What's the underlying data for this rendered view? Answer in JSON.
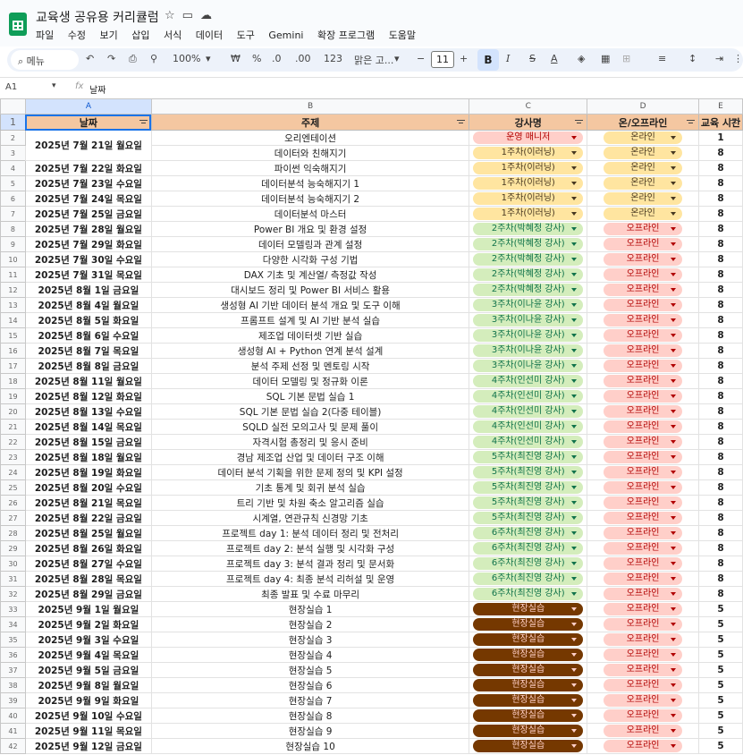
{
  "app": {
    "title": "교육생 공유용 커리큘럼",
    "menu": [
      "파일",
      "수정",
      "보기",
      "삽입",
      "서식",
      "데이터",
      "도구",
      "Gemini",
      "확장 프로그램",
      "도움말"
    ]
  },
  "toolbar": {
    "search_label": "메뉴",
    "zoom": "100%",
    "currency": "₩",
    "percent": "%",
    "dec_less": ".0",
    "dec_more": ".00",
    "number_format": "123",
    "font": "맑은 고...",
    "font_size": "11",
    "minus": "−",
    "plus": "+",
    "bold": "B",
    "italic": "I",
    "strike": "S",
    "textcolor": "A"
  },
  "formula_bar": {
    "cell_ref": "A1",
    "fx": "fx",
    "value": "날짜"
  },
  "columns": [
    "A",
    "B",
    "C",
    "D",
    "E"
  ],
  "headers": [
    "날짜",
    "주제",
    "강사명",
    "온/오프라인",
    "교육 시간"
  ],
  "colors": {
    "header_fill": "#f4c7a1",
    "selection": "#d3e3fd",
    "green_chip": "#d4edbc",
    "brown_chip": "#753800"
  },
  "rows": [
    {
      "n": "2",
      "date": "2025년 7월 21일 월요일",
      "topic": "오리엔테이션",
      "instructor": "운영 매니저",
      "chip": "mgr",
      "mode": "온라인",
      "hours": "1"
    },
    {
      "n": "3",
      "date": "",
      "topic": "데이터와 친해지기",
      "instructor": "1주차(이러닝)",
      "chip": "w1",
      "mode": "온라인",
      "hours": "8"
    },
    {
      "n": "4",
      "date": "2025년 7월 22일 화요일",
      "topic": "파이썬 익숙해지기",
      "instructor": "1주차(이러닝)",
      "chip": "w1",
      "mode": "온라인",
      "hours": "8"
    },
    {
      "n": "5",
      "date": "2025년 7월 23일 수요일",
      "topic": "데이터분석 능숙해지기 1",
      "instructor": "1주차(이러닝)",
      "chip": "w1",
      "mode": "온라인",
      "hours": "8"
    },
    {
      "n": "6",
      "date": "2025년 7월 24일 목요일",
      "topic": "데이터분석 능숙해지기 2",
      "instructor": "1주차(이러닝)",
      "chip": "w1",
      "mode": "온라인",
      "hours": "8"
    },
    {
      "n": "7",
      "date": "2025년 7월 25일 금요일",
      "topic": "데이터분석 마스터",
      "instructor": "1주차(이러닝)",
      "chip": "w1",
      "mode": "온라인",
      "hours": "8"
    },
    {
      "n": "8",
      "date": "2025년 7월 28일 월요일",
      "topic": "Power BI 개요 및 환경 설정",
      "instructor": "2주차(박혜정 강사)",
      "chip": "w2",
      "mode": "오프라인",
      "hours": "8"
    },
    {
      "n": "9",
      "date": "2025년 7월 29일 화요일",
      "topic": "데이터 모델링과 관계 설정",
      "instructor": "2주차(박혜정 강사)",
      "chip": "w2",
      "mode": "오프라인",
      "hours": "8"
    },
    {
      "n": "10",
      "date": "2025년 7월 30일 수요일",
      "topic": "다양한 시각화 구성 기법",
      "instructor": "2주차(박혜정 강사)",
      "chip": "w2",
      "mode": "오프라인",
      "hours": "8"
    },
    {
      "n": "11",
      "date": "2025년 7월 31일 목요일",
      "topic": "DAX 기초 및 계산열/ 측정값 작성",
      "instructor": "2주차(박혜정 강사)",
      "chip": "w2",
      "mode": "오프라인",
      "hours": "8"
    },
    {
      "n": "12",
      "date": "2025년 8월 1일 금요일",
      "topic": "대시보드 정리 및 Power BI 서비스 활용",
      "instructor": "2주차(박혜정 강사)",
      "chip": "w2",
      "mode": "오프라인",
      "hours": "8"
    },
    {
      "n": "13",
      "date": "2025년 8월 4일 월요일",
      "topic": "생성형 AI 기반 데이터 분석 개요 및 도구 이해",
      "instructor": "3주차(이나윤 강사)",
      "chip": "w3",
      "mode": "오프라인",
      "hours": "8"
    },
    {
      "n": "14",
      "date": "2025년 8월 5일 화요일",
      "topic": "프롬프트 설계 및 AI 기반 분석 실습",
      "instructor": "3주차(이나윤 강사)",
      "chip": "w3",
      "mode": "오프라인",
      "hours": "8"
    },
    {
      "n": "15",
      "date": "2025년 8월 6일 수요일",
      "topic": "제조업 데이터셋 기반 실습",
      "instructor": "3주차(이나윤 강사)",
      "chip": "w3",
      "mode": "오프라인",
      "hours": "8"
    },
    {
      "n": "16",
      "date": "2025년 8월 7일 목요일",
      "topic": "생성형 AI + Python 연계 분석 설계",
      "instructor": "3주차(이나윤 강사)",
      "chip": "w3",
      "mode": "오프라인",
      "hours": "8"
    },
    {
      "n": "17",
      "date": "2025년 8월 8일 금요일",
      "topic": "분석 주제 선정 및 멘토링 시작",
      "instructor": "3주차(이나윤 강사)",
      "chip": "w3",
      "mode": "오프라인",
      "hours": "8"
    },
    {
      "n": "18",
      "date": "2025년 8월 11일 월요일",
      "topic": "데이터 모델링 및 정규화 이론",
      "instructor": "4주차(인선미 강사)",
      "chip": "w4",
      "mode": "오프라인",
      "hours": "8"
    },
    {
      "n": "19",
      "date": "2025년 8월 12일 화요일",
      "topic": "SQL 기본 문법 실습 1",
      "instructor": "4주차(인선미 강사)",
      "chip": "w4",
      "mode": "오프라인",
      "hours": "8"
    },
    {
      "n": "20",
      "date": "2025년 8월 13일 수요일",
      "topic": "SQL 기본 문법 실습 2(다중 테이블)",
      "instructor": "4주차(인선미 강사)",
      "chip": "w4",
      "mode": "오프라인",
      "hours": "8"
    },
    {
      "n": "21",
      "date": "2025년 8월 14일 목요일",
      "topic": "SQLD 실전 모의고사 및 문제 풀이",
      "instructor": "4주차(인선미 강사)",
      "chip": "w4",
      "mode": "오프라인",
      "hours": "8"
    },
    {
      "n": "22",
      "date": "2025년 8월 15일 금요일",
      "topic": "자격시험 총정리 및 응시 준비",
      "instructor": "4주차(인선미 강사)",
      "chip": "w4",
      "mode": "오프라인",
      "hours": "8"
    },
    {
      "n": "23",
      "date": "2025년 8월 18일 월요일",
      "topic": "경남 제조업 산업 및 데이터 구조 이해",
      "instructor": "5주차(최진영 강사)",
      "chip": "w5",
      "mode": "오프라인",
      "hours": "8"
    },
    {
      "n": "24",
      "date": "2025년 8월 19일 화요일",
      "topic": "데이터 분석 기획을 위한 문제 정의 및 KPI 설정",
      "instructor": "5주차(최진영 강사)",
      "chip": "w5",
      "mode": "오프라인",
      "hours": "8"
    },
    {
      "n": "25",
      "date": "2025년 8월 20일 수요일",
      "topic": "기초 통계 및 회귀 분석 실습",
      "instructor": "5주차(최진영 강사)",
      "chip": "w5",
      "mode": "오프라인",
      "hours": "8"
    },
    {
      "n": "26",
      "date": "2025년 8월 21일 목요일",
      "topic": "트리 기반 및 차원 축소 알고리즘 실습",
      "instructor": "5주차(최진영 강사)",
      "chip": "w5",
      "mode": "오프라인",
      "hours": "8"
    },
    {
      "n": "27",
      "date": "2025년 8월 22일 금요일",
      "topic": "시계열, 연관규칙 신경망 기초",
      "instructor": "5주차(최진영 강사)",
      "chip": "w5",
      "mode": "오프라인",
      "hours": "8"
    },
    {
      "n": "28",
      "date": "2025년 8월 25일 월요일",
      "topic": "프로젝트 day 1: 분석 데이터 정리 및 전처리",
      "instructor": "6주차(최진영 강사)",
      "chip": "w6",
      "mode": "오프라인",
      "hours": "8"
    },
    {
      "n": "29",
      "date": "2025년 8월 26일 화요일",
      "topic": "프로젝트 day 2: 분석 실행 및 시각화 구성",
      "instructor": "6주차(최진영 강사)",
      "chip": "w6",
      "mode": "오프라인",
      "hours": "8"
    },
    {
      "n": "30",
      "date": "2025년 8월 27일 수요일",
      "topic": "프로젝트 day 3: 분석 결과 정리 및 문서화",
      "instructor": "6주차(최진영 강사)",
      "chip": "w6",
      "mode": "오프라인",
      "hours": "8"
    },
    {
      "n": "31",
      "date": "2025년 8월 28일 목요일",
      "topic": "프로젝트 day 4: 최종 분석 리허설 및 운영",
      "instructor": "6주차(최진영 강사)",
      "chip": "w6",
      "mode": "오프라인",
      "hours": "8"
    },
    {
      "n": "32",
      "date": "2025년 8월 29일 금요일",
      "topic": "최종 발표 및 수료 마무리",
      "instructor": "6주차(최진영 강사)",
      "chip": "w6",
      "mode": "오프라인",
      "hours": "8"
    },
    {
      "n": "33",
      "date": "2025년 9월 1일 월요일",
      "topic": "현장실습 1",
      "instructor": "현장실습",
      "chip": "site",
      "mode": "오프라인",
      "hours": "5"
    },
    {
      "n": "34",
      "date": "2025년 9월 2일 화요일",
      "topic": "현장실습 2",
      "instructor": "현장실습",
      "chip": "site",
      "mode": "오프라인",
      "hours": "5"
    },
    {
      "n": "35",
      "date": "2025년 9월 3일 수요일",
      "topic": "현장실습 3",
      "instructor": "현장실습",
      "chip": "site",
      "mode": "오프라인",
      "hours": "5"
    },
    {
      "n": "36",
      "date": "2025년 9월 4일 목요일",
      "topic": "현장실습 4",
      "instructor": "현장실습",
      "chip": "site",
      "mode": "오프라인",
      "hours": "5"
    },
    {
      "n": "37",
      "date": "2025년 9월 5일 금요일",
      "topic": "현장실습 5",
      "instructor": "현장실습",
      "chip": "site",
      "mode": "오프라인",
      "hours": "5"
    },
    {
      "n": "38",
      "date": "2025년 9월 8일 월요일",
      "topic": "현장실습 6",
      "instructor": "현장실습",
      "chip": "site",
      "mode": "오프라인",
      "hours": "5"
    },
    {
      "n": "39",
      "date": "2025년 9월 9일 화요일",
      "topic": "현장실습 7",
      "instructor": "현장실습",
      "chip": "site",
      "mode": "오프라인",
      "hours": "5"
    },
    {
      "n": "40",
      "date": "2025년 9월 10일 수요일",
      "topic": "현장실습 8",
      "instructor": "현장실습",
      "chip": "site",
      "mode": "오프라인",
      "hours": "5"
    },
    {
      "n": "41",
      "date": "2025년 9월 11일 목요일",
      "topic": "현장실습 9",
      "instructor": "현장실습",
      "chip": "site",
      "mode": "오프라인",
      "hours": "5"
    },
    {
      "n": "42",
      "date": "2025년 9월 12일 금요일",
      "topic": "현장실습 10",
      "instructor": "현장실습",
      "chip": "site",
      "mode": "오프라인",
      "hours": "5"
    }
  ]
}
